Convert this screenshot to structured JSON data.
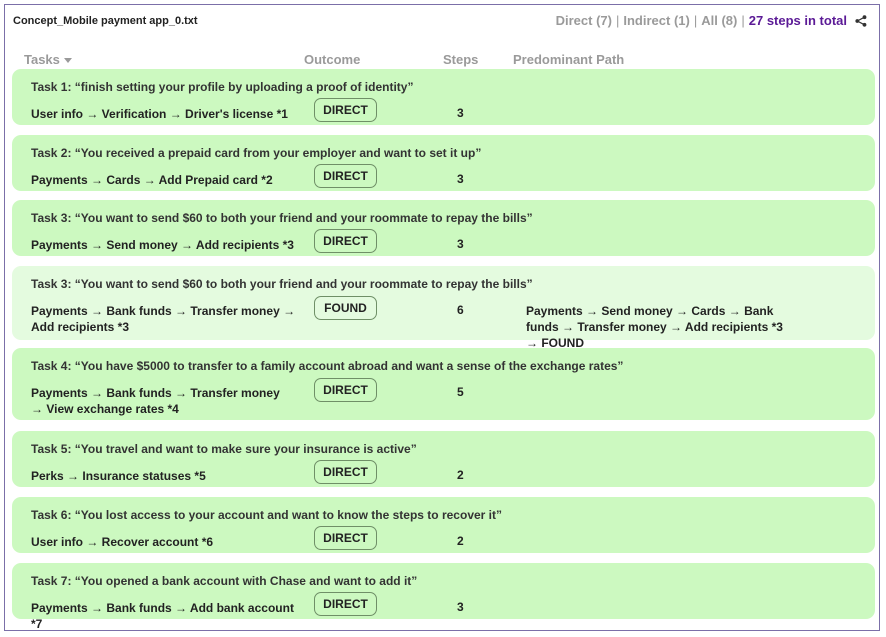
{
  "file_title": "Concept_Mobile payment app_0.txt",
  "summary": {
    "direct": "Direct (7)",
    "indirect": "Indirect (1)",
    "all": "All (8)",
    "total": "27 steps in total",
    "sep": "|"
  },
  "headers": {
    "tasks": "Tasks",
    "outcome": "Outcome",
    "steps": "Steps",
    "path": "Predominant Path"
  },
  "rows": [
    {
      "task": "Task 1: “finish setting your profile by uploading a proof of identity”",
      "path": "User info → Verification → Driver's license *1",
      "outcome": "DIRECT",
      "steps": "3",
      "pred": ""
    },
    {
      "task": "Task 2: “You received a prepaid card from your employer and want to set it up”",
      "path": "Payments → Cards → Add Prepaid card *2",
      "outcome": "DIRECT",
      "steps": "3",
      "pred": ""
    },
    {
      "task": "Task 3: “You want to send $60 to both your friend and your roommate to repay the bills”",
      "path": "Payments → Send money → Add recipients *3",
      "outcome": "DIRECT",
      "steps": "3",
      "pred": ""
    },
    {
      "task": "Task 3: “You want to send $60 to both your friend and your roommate to repay the bills”",
      "path": "Payments → Bank funds → Transfer money → Add recipients *3",
      "outcome": "FOUND",
      "steps": "6",
      "pred": "Payments → Send money → Cards → Bank funds → Transfer money → Add recipients *3 → FOUND"
    },
    {
      "task": "Task 4: “You have $5000 to transfer to a family account abroad and want a sense of the exchange rates”",
      "path": "Payments → Bank funds → Transfer money → View exchange rates *4",
      "outcome": "DIRECT",
      "steps": "5",
      "pred": ""
    },
    {
      "task": "Task 5: “You travel and want to make sure your insurance is active”",
      "path": "Perks → Insurance statuses *5",
      "outcome": "DIRECT",
      "steps": "2",
      "pred": ""
    },
    {
      "task": "Task 6: “You lost access to your account and want to know the steps to recover it”",
      "path": "User info → Recover account *6",
      "outcome": "DIRECT",
      "steps": "2",
      "pred": ""
    },
    {
      "task": "Task 7: “You opened a bank account with Chase and want to add it”",
      "path": "Payments → Bank funds → Add bank account *7",
      "outcome": "DIRECT",
      "steps": "3",
      "pred": ""
    }
  ]
}
